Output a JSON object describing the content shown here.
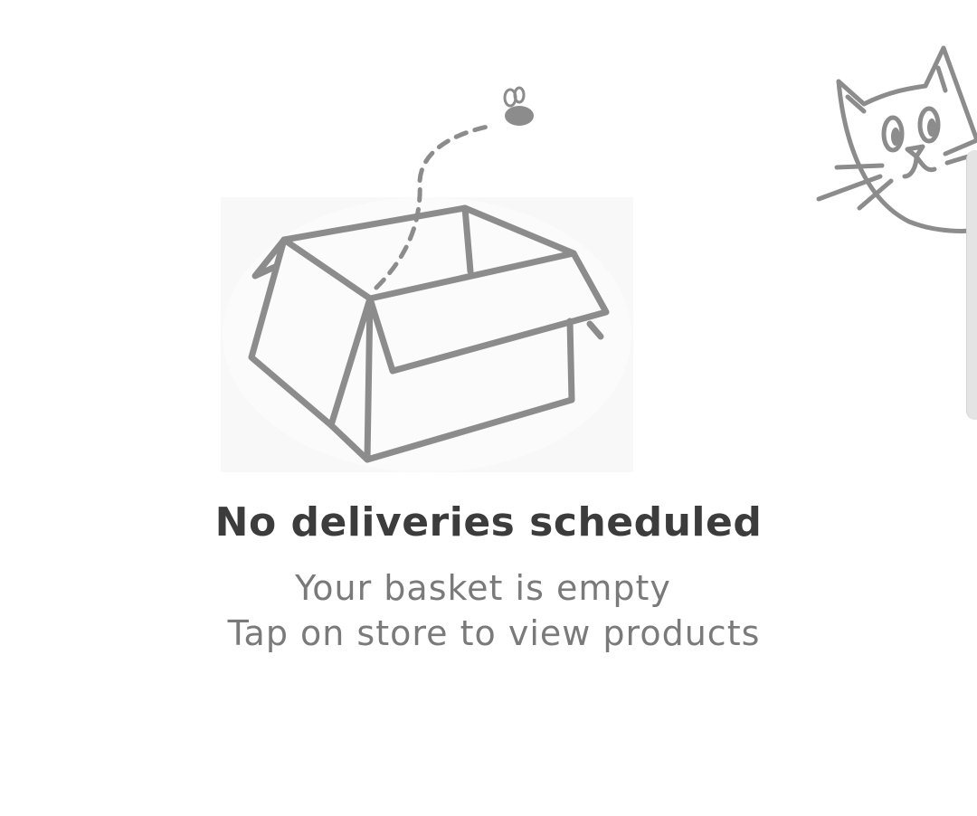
{
  "empty_state": {
    "title": "No deliveries scheduled",
    "line1": "Your basket is empty",
    "line2": "Tap on store to view products",
    "illustration": "empty-box-with-fly",
    "mascot": "cat-peeking"
  },
  "colors": {
    "title": "#3c3c3c",
    "subtitle": "#7a7a7a",
    "sketch": "#8c8c8c",
    "background": "#ffffff"
  }
}
